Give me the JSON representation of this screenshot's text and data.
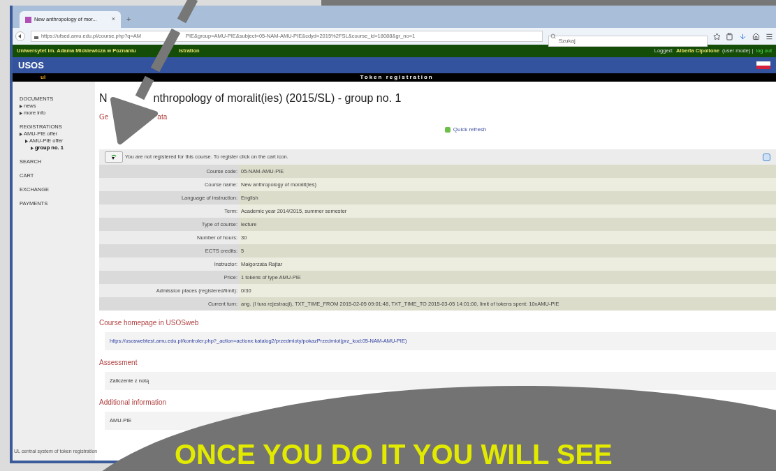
{
  "browser": {
    "tab": {
      "title": "New anthropology of mor...",
      "close": "×"
    },
    "new_tab": "+",
    "url_start": "https://ufsed.amu.edu.pl/course.php?q=AM",
    "url_end": "PIE&group=AMU-PIE&subject=05-NAM-AMU-PIE&cdyd=2015%2FSL&course_id=18088&gr_no=1",
    "search": {
      "placeholder": "Szukaj"
    }
  },
  "topbar": {
    "university": "Uniwersytet im. Adama Mickiewicza w Poznaniu",
    "suffix": "istration",
    "logged_label": "Logged:",
    "user": "Alberta Cipollone",
    "mode": "(user mode) |",
    "logout": "log out"
  },
  "header": {
    "logo": "USOS",
    "sublogo": "ul",
    "title": "Token registration"
  },
  "sidebar": {
    "groups": [
      {
        "label": "DOCUMENTS",
        "children": [
          {
            "label": "news",
            "selected": false
          },
          {
            "label": "more info",
            "selected": false
          }
        ]
      },
      {
        "label": "REGISTRATIONS",
        "children": [
          {
            "label": "AMU-PIE offer",
            "selected": false,
            "children": [
              {
                "label": "AMU-PIE offer",
                "selected": false,
                "children": [
                  {
                    "label": "group no. 1",
                    "selected": true
                  }
                ]
              }
            ]
          }
        ]
      },
      {
        "label": "SEARCH"
      },
      {
        "label": "CART"
      },
      {
        "label": "EXCHANGE"
      },
      {
        "label": "PAYMENTS"
      }
    ],
    "footer": "UL central system of token registration"
  },
  "page": {
    "title_start": "N",
    "title_end": "nthropology of moralit(ies) (2015/SL) - group no. 1",
    "section_start": "Ge",
    "section_end": "ata",
    "quick_refresh": "Quick refresh",
    "notice": "You are not registered for this course. To register click on the cart icon.",
    "rows": [
      {
        "label": "Course code:",
        "value": "05-NAM-AMU-PIE"
      },
      {
        "label": "Course name:",
        "value": "New anthropology of moralit(ies)"
      },
      {
        "label": "Language of instruction:",
        "value": "English"
      },
      {
        "label": "Term:",
        "value": "Academic year 2014/2015, summer semester"
      },
      {
        "label": "Type of course:",
        "value": "lecture"
      },
      {
        "label": "Number of hours:",
        "value": "30"
      },
      {
        "label": "ECTS credits:",
        "value": "5"
      },
      {
        "label": "Instructor:",
        "value": "Małgorzata Rajtar"
      },
      {
        "label": "Price:",
        "value": "1 tokens of type AMU-PIE"
      },
      {
        "label": "Admission places (registered/limit):",
        "value": "0/30"
      },
      {
        "label": "Current turn:",
        "value": "ang. (I tura rejestracji), TXT_TIME_FROM 2015-02-05 09:01:48, TXT_TIME_TO 2015-03-05 14:01:00, limit of tokens spent: 10xAMU-PIE"
      }
    ],
    "sections": [
      {
        "kind": "link",
        "heading": "Course homepage in USOSweb",
        "text": "https://usoswebtest.amu.edu.pl/kontroler.php?_action=actionx:katalog2/przedmioty/pokazPrzedmiot(prz_kod:05-NAM-AMU-PIE)"
      },
      {
        "kind": "text",
        "heading": "Assessment",
        "text": "Zaliczenie z notą"
      },
      {
        "kind": "text",
        "heading": "Additional information",
        "text": "AMU-PIE"
      }
    ]
  },
  "overlay": {
    "caption": "ONCE YOU DO IT YOU WILL SEE"
  }
}
